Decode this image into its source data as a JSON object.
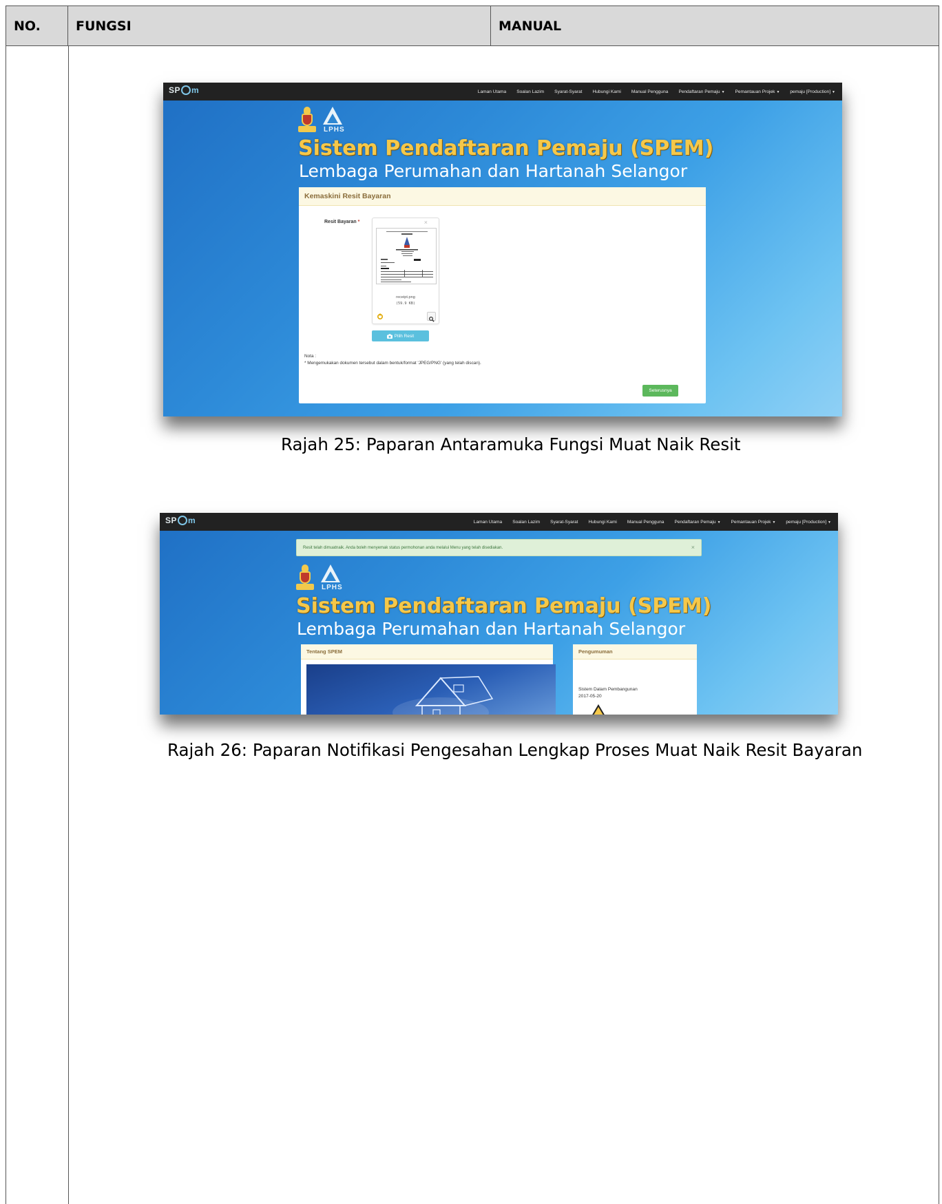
{
  "table": {
    "headers": {
      "no": "NO.",
      "fungsi": "FUNGSI",
      "manual": "MANUAL"
    }
  },
  "nav": {
    "brand": {
      "pre": "SP",
      "post": "m"
    },
    "items": [
      {
        "label": "Laman Utama",
        "dropdown": false
      },
      {
        "label": "Soalan Lazim",
        "dropdown": false
      },
      {
        "label": "Syarat-Syarat",
        "dropdown": false
      },
      {
        "label": "Hubungi Kami",
        "dropdown": false
      },
      {
        "label": "Manual Pengguna",
        "dropdown": false
      },
      {
        "label": "Pendaftaran Pemaju",
        "dropdown": true
      },
      {
        "label": "Pemantauan Projek",
        "dropdown": true
      },
      {
        "label": "pemaju [Production]",
        "dropdown": true
      }
    ]
  },
  "site": {
    "title": "Sistem Pendaftaran Pemaju (SPEM)",
    "subtitle": "Lembaga Perumahan dan Hartanah Selangor",
    "logo_text": "LPHS"
  },
  "figure1": {
    "panel_title": "Kemaskini Resit Bayaran",
    "field_label": "Resit Bayaran",
    "required_mark": "*",
    "close": "×",
    "file_name": "receipt.png",
    "file_size": "(59.9 KB)",
    "choose_button": "Pilih Resit",
    "note_title": "Nota :",
    "note_text": "* Mengemukakan dokumen tersebut dalam bentuk/format 'JPEG/PNG' (yang telah discan).",
    "next_button": "Seterusnya",
    "caption": "Rajah 25: Paparan Antaramuka Fungsi Muat Naik Resit"
  },
  "figure2": {
    "alert_text": "Resit telah dimuatnaik. Anda boleh menyemak status permohonan anda melalui Menu yang telah disediakan.",
    "alert_close": "×",
    "panel_about_title": "Tentang SPEM",
    "panel_news_title": "Pengumuman",
    "news_title": "Sistem Dalam Pembangunan",
    "news_date": "2017-05-20",
    "caption": "Rajah 26: Paparan Notifikasi Pengesahan Lengkap Proses Muat Naik Resit Bayaran"
  },
  "colors": {
    "navbar": "#222222",
    "panel_heading_bg": "#fcf8e3",
    "panel_heading_text": "#8a6d3b",
    "btn_info": "#5bc0de",
    "btn_success": "#5cb85c",
    "alert_bg": "#dff0d8",
    "title_gold": "#f5c84a"
  },
  "icons": [
    "camera-icon",
    "zoom-icon",
    "upload-icon",
    "warning-icon",
    "house-icon"
  ]
}
